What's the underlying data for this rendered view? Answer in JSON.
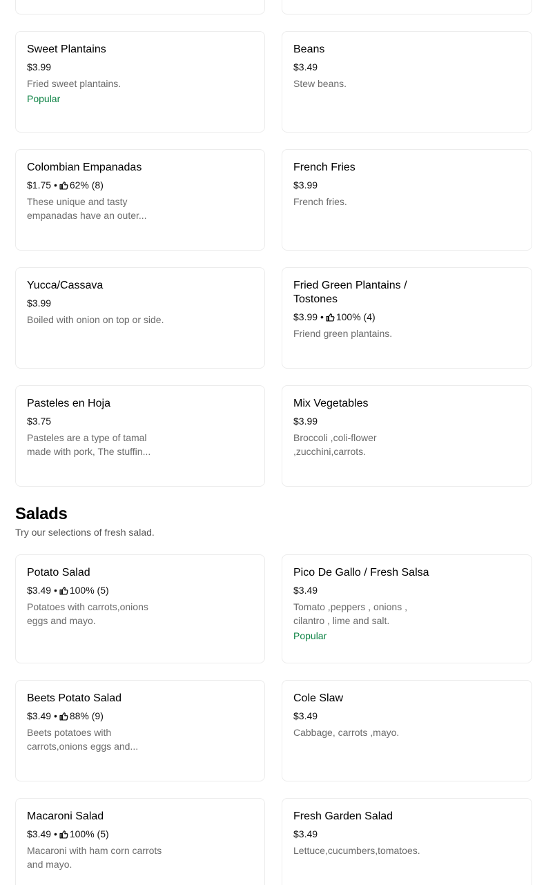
{
  "sides_section": {
    "items": [
      {
        "name": "Sweet Plantains",
        "price": "$3.99",
        "description": "Fried sweet plantains.",
        "badge": "Popular"
      },
      {
        "name": "Beans",
        "price": "$3.49",
        "description": "Stew beans."
      },
      {
        "name": "Colombian Empanadas",
        "price": "$1.75",
        "rating": "62% (8)",
        "description": "These unique and tasty empanadas have an outer..."
      },
      {
        "name": "French Fries",
        "price": "$3.99",
        "description": "French fries."
      },
      {
        "name": "Yucca/Cassava",
        "price": "$3.99",
        "description": "Boiled with onion on top or side."
      },
      {
        "name": "Fried Green Plantains / Tostones",
        "price": "$3.99",
        "rating": "100% (4)",
        "description": "Friend green plantains."
      },
      {
        "name": "Pasteles en Hoja",
        "price": "$3.75",
        "description": "Pasteles are a type of tamal made with pork, The stuffin..."
      },
      {
        "name": "Mix Vegetables",
        "price": "$3.99",
        "description": "Broccoli ,coli-flower ,zucchini,carrots."
      }
    ]
  },
  "salads_section": {
    "title": "Salads",
    "description": "Try our selections of fresh salad.",
    "items": [
      {
        "name": "Potato Salad",
        "price": "$3.49",
        "rating": "100% (5)",
        "description": "Potatoes with carrots,onions eggs and mayo."
      },
      {
        "name": "Pico De Gallo / Fresh Salsa",
        "price": "$3.49",
        "description": "Tomato ,peppers , onions , cilantro , lime and salt.",
        "badge": "Popular"
      },
      {
        "name": "Beets Potato Salad",
        "price": "$3.49",
        "rating": "88% (9)",
        "description": "Beets potatoes with carrots,onions eggs and..."
      },
      {
        "name": "Cole Slaw",
        "price": "$3.49",
        "description": "Cabbage, carrots ,mayo."
      },
      {
        "name": "Macaroni Salad",
        "price": "$3.49",
        "rating": "100% (5)",
        "description": "Macaroni with ham corn carrots and mayo."
      },
      {
        "name": "Fresh Garden Salad",
        "price": "$3.49",
        "description": "Lettuce,cucumbers,tomatoes."
      }
    ]
  },
  "separator": "•",
  "colors": {
    "popular": "#0e8345",
    "card_border": "#ececec",
    "desc_text": "#6b6b6b"
  },
  "icons": {
    "rating": "thumbs-up-icon"
  }
}
